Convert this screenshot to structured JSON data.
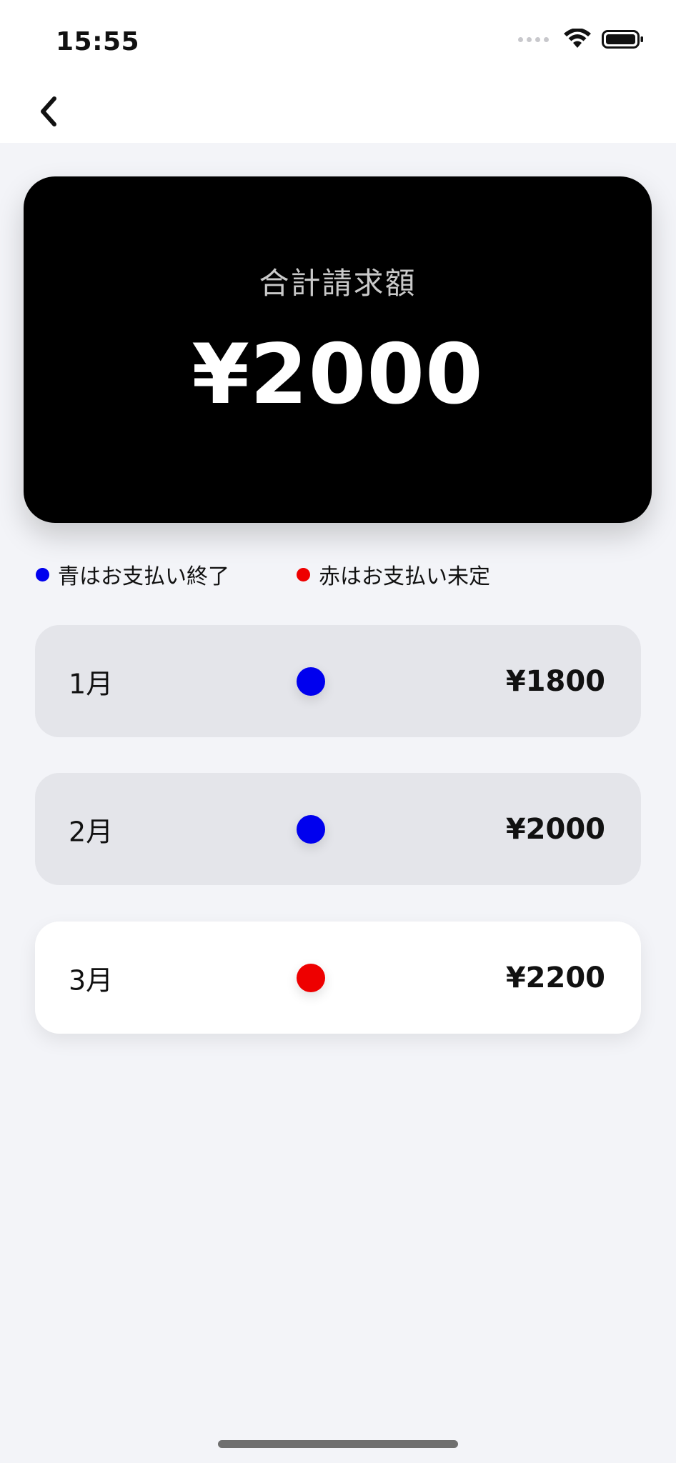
{
  "status_bar": {
    "time": "15:55",
    "signal_icon": "cellular-dots-icon",
    "wifi_icon": "wifi-icon",
    "battery_icon": "battery-icon"
  },
  "header": {
    "back_icon": "chevron-left-icon"
  },
  "total": {
    "label": "合計請求額",
    "amount": "¥2000"
  },
  "legend": {
    "paid_label": "青はお支払い終了",
    "paid_color": "#0000ee",
    "unpaid_label": "赤はお支払い未定",
    "unpaid_color": "#ee0000"
  },
  "months": [
    {
      "label": "1月",
      "amount": "¥1800",
      "status": "paid",
      "dot_color": "#0000ee"
    },
    {
      "label": "2月",
      "amount": "¥2000",
      "status": "paid",
      "dot_color": "#0000ee"
    },
    {
      "label": "3月",
      "amount": "¥2200",
      "status": "unpaid",
      "dot_color": "#ee0000"
    }
  ]
}
